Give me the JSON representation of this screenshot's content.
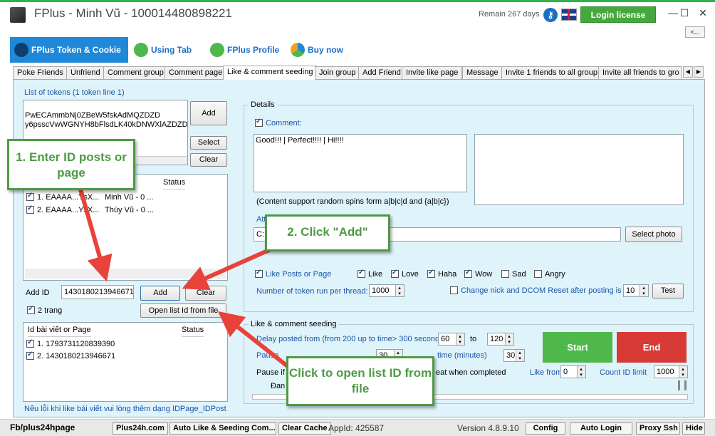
{
  "window": {
    "title": "FPlus - Minh Vũ - 100014480898221",
    "remain": "Remain 267 days",
    "login_license": "Login license",
    "minimize": "—",
    "maximize": "☐",
    "close": "✕",
    "back": "<..."
  },
  "top_tabs": [
    {
      "label": "FPlus Token & Cookie"
    },
    {
      "label": "Using Tab"
    },
    {
      "label": "FPlus Profile"
    },
    {
      "label": "Buy now"
    }
  ],
  "sub_tabs": [
    "Poke Friends",
    "Unfriend",
    "Comment group",
    "Comment page",
    "Like & comment seeding",
    "Join group",
    "Add Friend",
    "Invite like page",
    "Message",
    "Invite 1 friends to all group",
    "Invite all friends to gro"
  ],
  "tokens": {
    "label": "List of tokens (1 token line 1)",
    "line1": "PwECAmmbNj0ZBeW5fskAdMQZDZD",
    "line2": "y6psscVwWGNYH8bFlsdLK40kDNWXlAZDZD",
    "add": "Add",
    "select": "Select",
    "clear": "Clear",
    "col_status": "Status",
    "rows": [
      {
        "name": "1. EAAAA...YsX...",
        "user": "Minh Vũ - 0 ..."
      },
      {
        "name": "2. EAAAA...YsX...",
        "user": "Thúy Vũ - 0 ..."
      }
    ]
  },
  "add_id": {
    "label": "Add ID",
    "value": "1430180213946671",
    "add": "Add",
    "clear": "Clear",
    "two_pages": "2 trang",
    "open_list": "Open list Id from file",
    "col_id": "Id bài viết or Page",
    "col_status": "Status",
    "rows": [
      "1. 1793731120839390",
      "2. 1430180213946671"
    ],
    "note": "Nếu lỗi khi like bài viết vui lòng thêm dạng IDPage_IDPost"
  },
  "details": {
    "title": "Details",
    "comment_label": "Comment:",
    "comment_text": "Good!!! | Perfect!!!! | Hi!!!!",
    "spin_note": "(Content support random spins form a|b|c|d and {a|b|c})",
    "attach_label": "Att...ty)",
    "attach_value": "C:...ong",
    "select_photo": "Select photo",
    "like_posts": "Like Posts or Page",
    "reactions": [
      "Like",
      "Love",
      "Haha",
      "Wow",
      "Sad",
      "Angry"
    ],
    "threads_label": "Number of token run per thread:",
    "threads_value": "1000",
    "change_nick": "Change nick and DCOM Reset after posting is",
    "change_value": "10",
    "test": "Test"
  },
  "seeding": {
    "title": "Like & comment seeding",
    "delay_label": "Delay posted from (from 200 up to time> 300 seconds)",
    "delay_from": "60",
    "to": "to",
    "delay_to": "120",
    "pause_label": "Pause",
    "pause_value": "30",
    "time_minutes": "time (minutes)",
    "time_value": "30",
    "pause_if": "Pause if",
    "repeat": "eat when completed",
    "like_from": "Like from",
    "like_from_value": "0",
    "count_limit": "Count ID limit",
    "count_value": "1000",
    "dan": "Đan",
    "start": "Start",
    "end": "End"
  },
  "callouts": {
    "c1": "1. Enter ID posts or page",
    "c2": "2. Click \"Add\"",
    "c3": "Click to open list ID from file"
  },
  "status_bar": {
    "fb": "Fb/plus24hpage",
    "site": "Plus24h.com",
    "auto_like": "Auto Like & Seeding Com...",
    "clear_cache": "Clear Cache",
    "appid": "AppId: 425587",
    "version": "Version 4.8.9.10",
    "config": "Config",
    "auto_login": "Auto Login",
    "proxy": "Proxy Ssh",
    "hide": "Hide"
  },
  "colors": {
    "accent": "#1f88d9",
    "green": "#4fb84a",
    "red": "#d83a36",
    "callout": "#4e9a45"
  }
}
